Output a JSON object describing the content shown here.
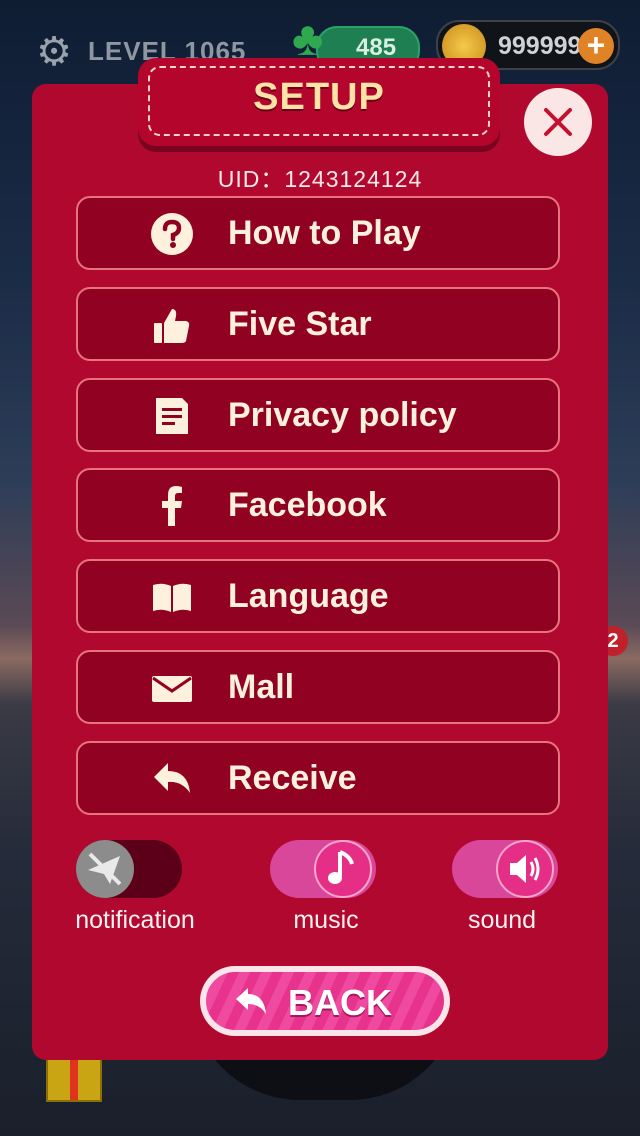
{
  "hud": {
    "level": "LEVEL 1065",
    "clovers": "485",
    "coins": "999999",
    "plus": "+",
    "badge": "2"
  },
  "dialog": {
    "title": "SETUP",
    "uid": "UID：1243124124",
    "menu": [
      {
        "label": "How to Play",
        "icon": "question-icon"
      },
      {
        "label": "Five Star",
        "icon": "thumbs-up-icon"
      },
      {
        "label": "Privacy policy",
        "icon": "document-icon"
      },
      {
        "label": "Facebook",
        "icon": "facebook-icon"
      },
      {
        "label": "Language",
        "icon": "book-icon"
      },
      {
        "label": "Mall",
        "icon": "envelope-icon"
      },
      {
        "label": "Receive",
        "icon": "reply-icon"
      }
    ],
    "toggles": [
      {
        "label": "notification",
        "on": false
      },
      {
        "label": "music",
        "on": true
      },
      {
        "label": "sound",
        "on": true
      }
    ],
    "back_label": "BACK"
  },
  "colors": {
    "panel": "#b1082f",
    "button": "#900122",
    "toggle_on": "#d9479a",
    "back": "#e8338c"
  }
}
